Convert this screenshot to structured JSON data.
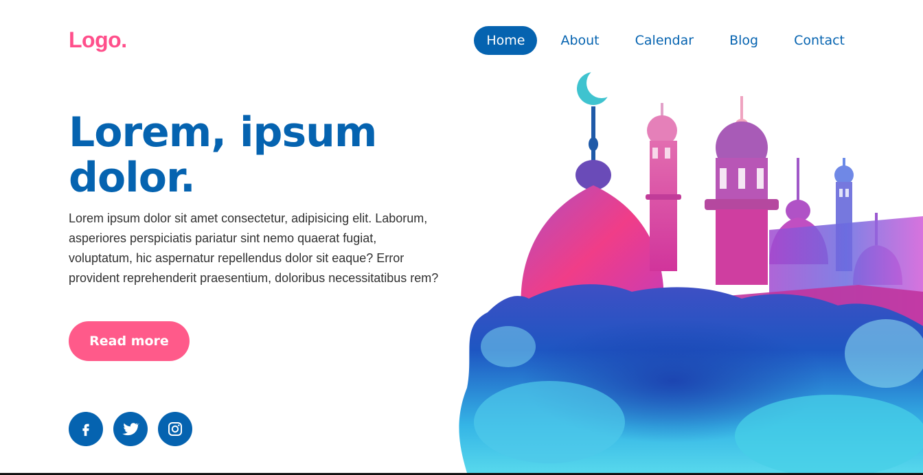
{
  "brand": {
    "logo": "Logo."
  },
  "nav": {
    "items": [
      {
        "label": "Home",
        "active": true
      },
      {
        "label": "About",
        "active": false
      },
      {
        "label": "Calendar",
        "active": false
      },
      {
        "label": "Blog",
        "active": false
      },
      {
        "label": "Contact",
        "active": false
      }
    ]
  },
  "hero": {
    "title_line1": "Lorem, ipsum",
    "title_line2": "dolor.",
    "body": "Lorem ipsum dolor sit amet consectetur, adipisicing elit. Laborum, asperiores perspiciatis pariatur sint nemo quaerat fugiat, voluptatum, hic aspernatur repellendus dolor sit eaque? Error provident reprehenderit praesentium, doloribus necessitatibus rem?",
    "cta_label": "Read more"
  },
  "social": {
    "icons": [
      "facebook-icon",
      "twitter-icon",
      "instagram-icon"
    ]
  },
  "illustration": {
    "name": "watercolor-mosque-illustration"
  },
  "colors": {
    "brand_pink": "#ff4f8b",
    "primary_blue": "#0563b0",
    "cta_pink": "#ff5a8a",
    "text_dark": "#303030"
  }
}
